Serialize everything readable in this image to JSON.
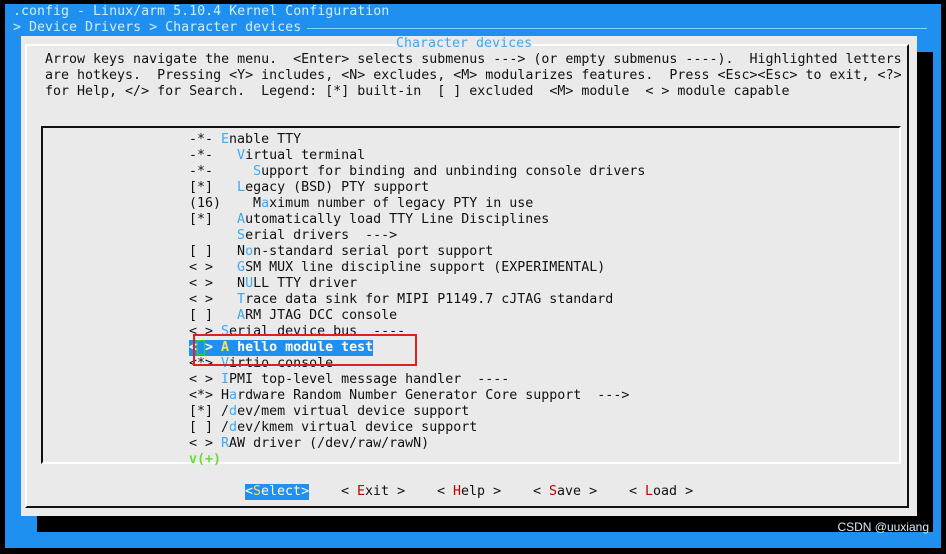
{
  "window": {
    "title": ".config - Linux/arm 5.10.4 Kernel Configuration",
    "breadcrumb": "> Device Drivers > Character devices"
  },
  "dialog": {
    "title": "Character devices",
    "help_lines": [
      "Arrow keys navigate the menu.  <Enter> selects submenus ---> (or empty submenus ----).  Highlighted letters",
      "are hotkeys.  Pressing <Y> includes, <N> excludes, <M> modularizes features.  Press <Esc><Esc> to exit, <?>",
      "for Help, </> for Search.  Legend: [*] built-in  [ ] excluded  <M> module  < > module capable"
    ]
  },
  "menu": {
    "items": [
      {
        "state": "-*- ",
        "pre": "",
        "hot": "E",
        "post": "nable TTY"
      },
      {
        "state": "-*- ",
        "pre": "  ",
        "hot": "V",
        "post": "irtual terminal"
      },
      {
        "state": "-*- ",
        "pre": "    ",
        "hot": "S",
        "post": "upport for binding and unbinding console drivers"
      },
      {
        "state": "[*] ",
        "pre": "  ",
        "hot": "L",
        "post": "egacy (BSD) PTY support"
      },
      {
        "state": "(16)",
        "pre": "    M",
        "hot": "a",
        "post": "ximum number of legacy PTY in use"
      },
      {
        "state": "[*] ",
        "pre": "  ",
        "hot": "A",
        "post": "utomatically load TTY Line Disciplines"
      },
      {
        "state": "    ",
        "pre": "  ",
        "hot": "S",
        "post": "erial drivers  --->"
      },
      {
        "state": "[ ] ",
        "pre": "  N",
        "hot": "o",
        "post": "n-standard serial port support"
      },
      {
        "state": "< > ",
        "pre": "  ",
        "hot": "G",
        "post": "SM MUX line discipline support (EXPERIMENTAL)"
      },
      {
        "state": "< > ",
        "pre": "  N",
        "hot": "U",
        "post": "LL TTY driver"
      },
      {
        "state": "< > ",
        "pre": "  ",
        "hot": "T",
        "post": "race data sink for MIPI P1149.7 cJTAG standard"
      },
      {
        "state": "[ ] ",
        "pre": "  ",
        "hot": "A",
        "post": "RM JTAG DCC console"
      },
      {
        "state": "< > ",
        "pre": "",
        "hot": "S",
        "post": "erial device bus  ----"
      },
      {
        "state": "< > ",
        "pre": "",
        "hot": "A",
        "post": " hello module test",
        "selected": true
      },
      {
        "state": "<*> ",
        "pre": "",
        "hot": "V",
        "post": "irtio console"
      },
      {
        "state": "< > ",
        "pre": "",
        "hot": "I",
        "post": "PMI top-level message handler  ----"
      },
      {
        "state": "<*> ",
        "pre": "H",
        "hot": "a",
        "post": "rdware Random Number Generator Core support  --->"
      },
      {
        "state": "[*] ",
        "pre": "/",
        "hot": "d",
        "post": "ev/mem virtual device support"
      },
      {
        "state": "[ ] ",
        "pre": "/",
        "hot": "d",
        "post": "ev/kmem virtual device support"
      },
      {
        "state": "< > ",
        "pre": "",
        "hot": "R",
        "post": "AW driver (/dev/raw/rawN)"
      }
    ],
    "more_indicator": "v(+)"
  },
  "buttons": [
    {
      "l": "<",
      "hot": "S",
      "rest": "elect",
      "r": ">",
      "active": true
    },
    {
      "l": "< ",
      "hot": "E",
      "rest": "xit",
      "r": " >"
    },
    {
      "l": "< ",
      "hot": "H",
      "rest": "elp",
      "r": " >"
    },
    {
      "l": "< ",
      "hot": "S",
      "rest": "ave",
      "r": " >"
    },
    {
      "l": "< ",
      "hot": "L",
      "rest": "oad",
      "r": " >"
    }
  ],
  "watermark": "CSDN @uuxiang",
  "colors": {
    "screen": "#1f8ff0",
    "dialog": "#eaeaea",
    "hotkey": "#3da8f5",
    "highlight": "#1f8ff0",
    "annotation": "#e02020"
  }
}
